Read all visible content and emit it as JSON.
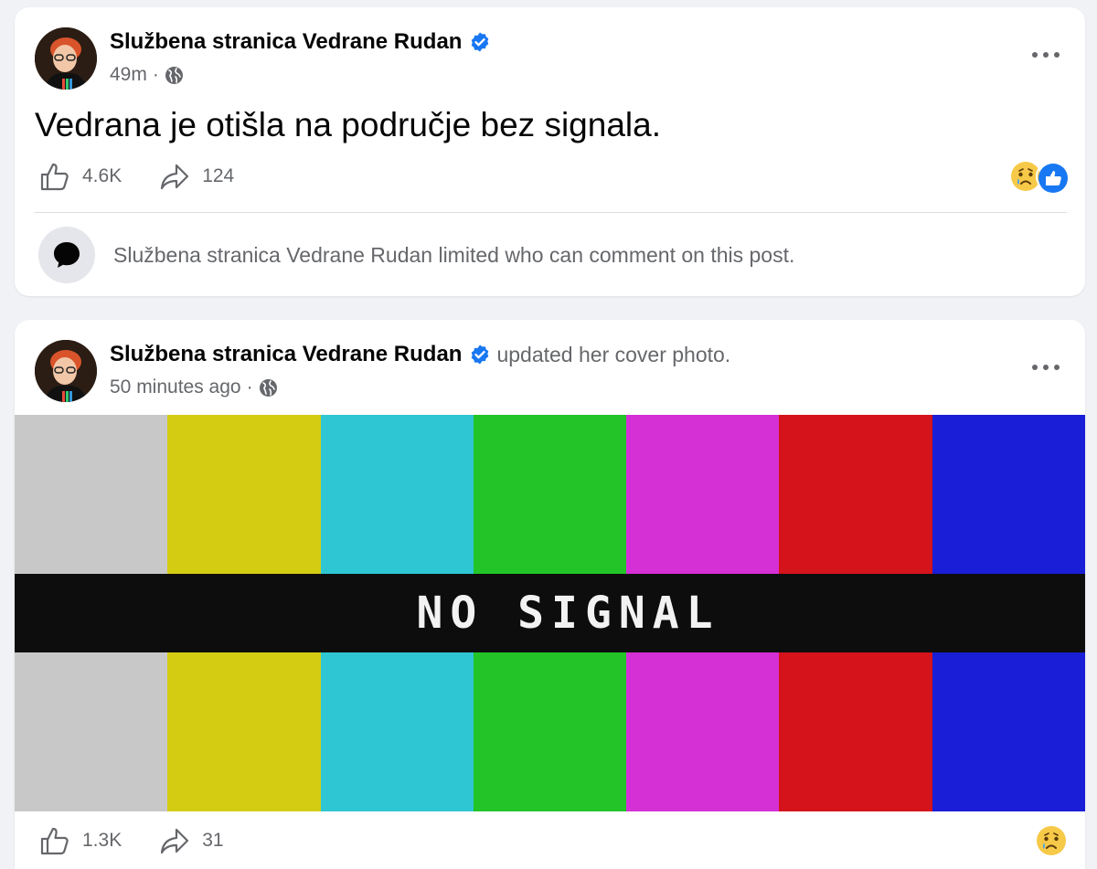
{
  "posts": [
    {
      "author": "Službena stranica Vedrane Rudan",
      "time": "49m",
      "text": "Vedrana je otišla na područje bez signala.",
      "likes": "4.6K",
      "shares": "124",
      "comment_notice": "Službena stranica Vedrane Rudan limited who can comment on this post."
    },
    {
      "author": "Službena stranica Vedrane Rudan",
      "action": "updated her cover photo.",
      "time": "50 minutes ago",
      "cover_text": "NO SIGNAL",
      "likes": "1.3K",
      "shares": "31"
    }
  ],
  "meta": {
    "separator": "·"
  },
  "icons": {
    "verified": "verified-badge-icon",
    "privacy": "globe-icon",
    "menu": "more-options-icon",
    "like": "thumbs-up-icon",
    "share": "share-arrow-icon",
    "reaction_sad": "sad-reaction-icon",
    "reaction_like": "like-reaction-icon",
    "comment": "comment-bubble-icon"
  },
  "colors": {
    "accent": "#1877f2",
    "text_secondary": "#65676b",
    "cover_bars": [
      "#c8c8c8",
      "#d4cc13",
      "#2ec6d3",
      "#22c428",
      "#d52fd6",
      "#d4131a",
      "#1a1ed6"
    ]
  }
}
